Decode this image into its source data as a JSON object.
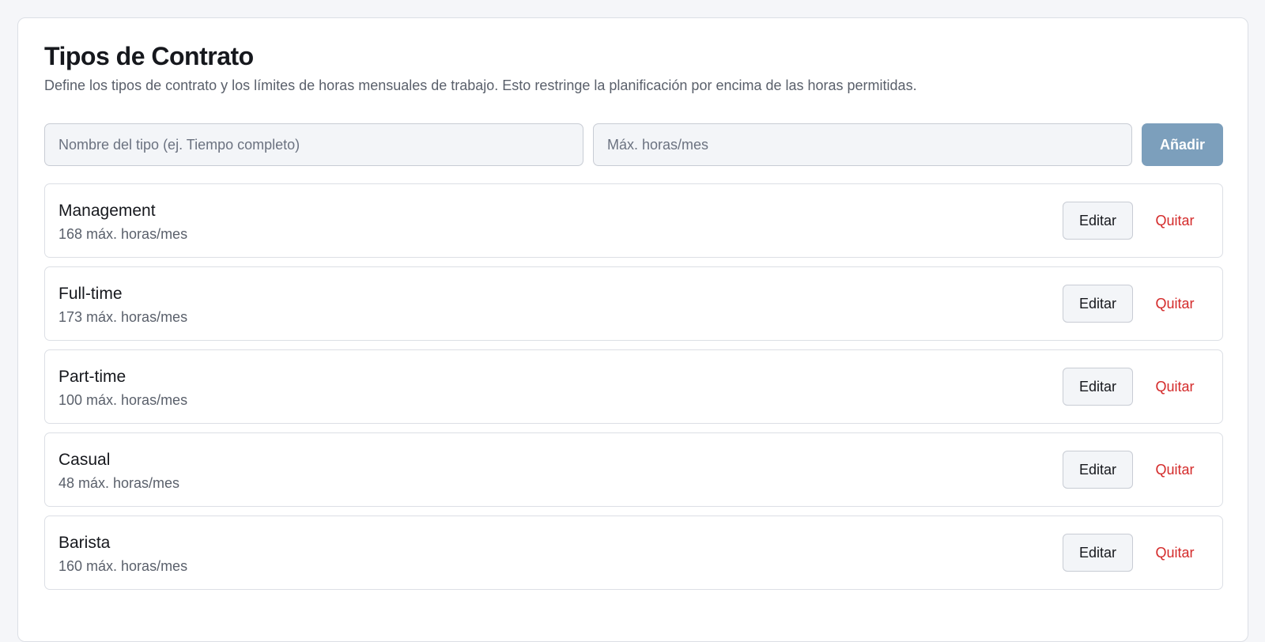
{
  "header": {
    "title": "Tipos de Contrato",
    "subtitle": "Define los tipos de contrato y los límites de horas mensuales de trabajo. Esto restringe la planificación por encima de las horas permitidas."
  },
  "form": {
    "name_placeholder": "Nombre del tipo (ej. Tiempo completo)",
    "name_value": "",
    "hours_placeholder": "Máx. horas/mes",
    "hours_value": "",
    "add_label": "Añadir"
  },
  "actions": {
    "edit_label": "Editar",
    "remove_label": "Quitar"
  },
  "contract_types": [
    {
      "name": "Management",
      "hours": "168 máx. horas/mes"
    },
    {
      "name": "Full-time",
      "hours": "173 máx. horas/mes"
    },
    {
      "name": "Part-time",
      "hours": "100 máx. horas/mes"
    },
    {
      "name": "Casual",
      "hours": "48 máx. horas/mes"
    },
    {
      "name": "Barista",
      "hours": "160 máx. horas/mes"
    }
  ],
  "colors": {
    "accent_button": "#7c9fbc",
    "danger_text": "#d42a2a",
    "page_background": "#f5f6f9"
  }
}
